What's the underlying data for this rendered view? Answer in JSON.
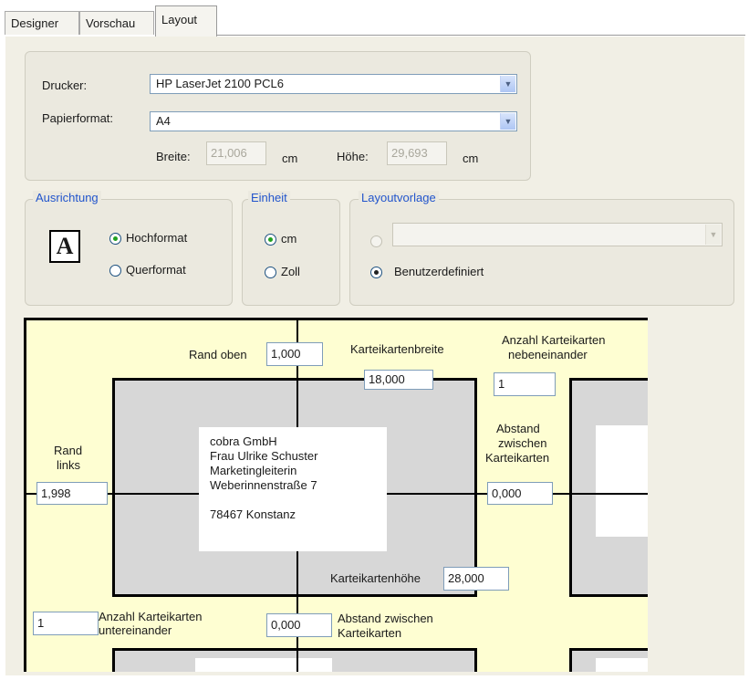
{
  "tabs": [
    {
      "label": "Designer",
      "active": false
    },
    {
      "label": "Vorschau",
      "active": false
    },
    {
      "label": "Layout",
      "active": true
    }
  ],
  "printer": {
    "printer_label": "Drucker:",
    "printer_value": "HP LaserJet 2100 PCL6",
    "format_label": "Papierformat:",
    "format_value": "A4",
    "width_label": "Breite:",
    "width_value": "21,006",
    "width_unit": "cm",
    "height_label": "Höhe:",
    "height_value": "29,693",
    "height_unit": "cm"
  },
  "orientation": {
    "legend": "Ausrichtung",
    "page_icon_glyph": "A",
    "portrait": "Hochformat",
    "landscape": "Querformat",
    "selected": "Hochformat"
  },
  "unit": {
    "legend": "Einheit",
    "cm": "cm",
    "inch": "Zoll",
    "selected": "cm"
  },
  "template": {
    "legend": "Layoutvorlage",
    "combo_value": "",
    "custom": "Benutzerdefiniert",
    "selected": "Benutzerdefiniert"
  },
  "preview": {
    "rand_oben_label": "Rand oben",
    "rand_oben_value": "1,000",
    "card_width_label": "Karteikartenbreite",
    "card_width_value": "18,000",
    "count_across_label_1": "Anzahl Karteikarten",
    "count_across_label_2": "nebeneinander",
    "count_across_value": "1",
    "rand_links_label_1": "Rand",
    "rand_links_label_2": "links",
    "rand_links_value": "1,998",
    "gap_h_label_1": "Abstand",
    "gap_h_label_2": "zwischen",
    "gap_h_label_3": "Karteikarten",
    "gap_h_value": "0,000",
    "card_height_label": "Karteikartenhöhe",
    "card_height_value": "28,000",
    "count_down_value": "1",
    "count_down_label_1": "Anzahl Karteikarten",
    "count_down_label_2": "untereinander",
    "gap_v_value": "0,000",
    "gap_v_label_1": "Abstand zwischen",
    "gap_v_label_2": "Karteikarten",
    "address": {
      "line1": "cobra GmbH",
      "line2": "Frau Ulrike Schuster",
      "line3": "Marketingleiterin",
      "line4": "Weberinnenstraße 7",
      "line5": "78467 Konstanz"
    }
  }
}
